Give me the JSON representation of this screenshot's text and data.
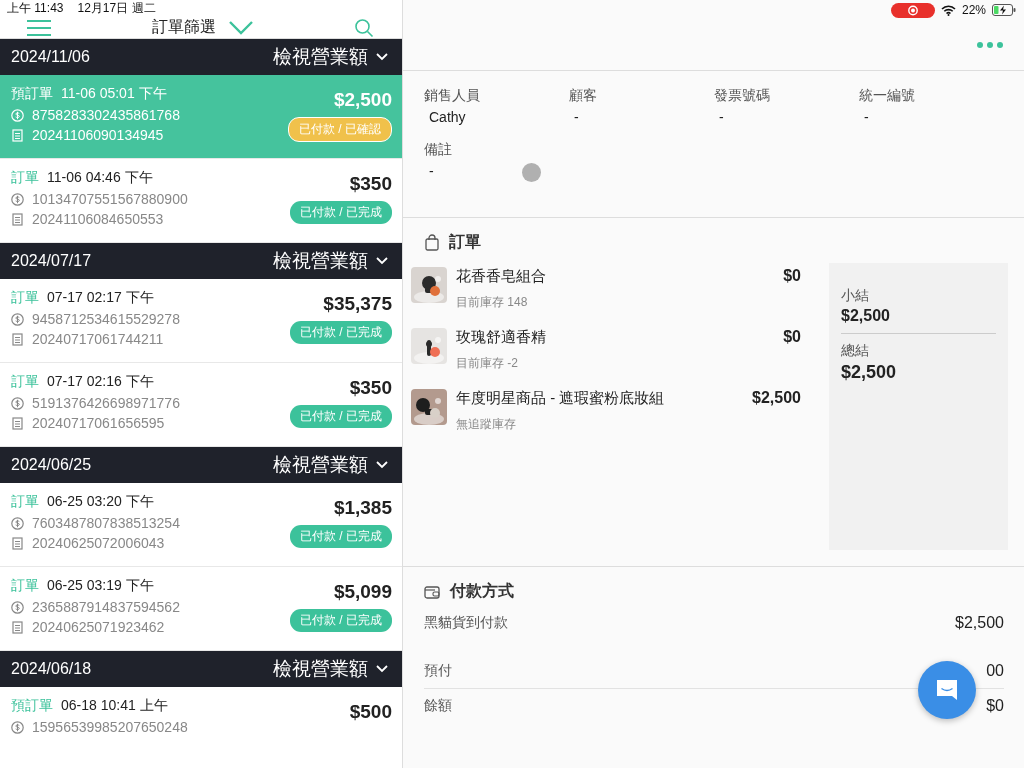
{
  "status_bar": {
    "time": "上午 11:43",
    "date": "12月17日 週二",
    "battery_text": "22%"
  },
  "nav": {
    "title": "訂單篩選"
  },
  "order_groups": [
    {
      "date": "2024/11/06",
      "action": "檢視營業額",
      "orders": [
        {
          "type": "預訂單",
          "time": "11-06 05:01 下午",
          "payment_no": "8758283302435861768",
          "order_no": "20241106090134945",
          "amount": "$2,500",
          "status": {
            "label": "已付款 / 已確認",
            "color": "#f0c14b"
          },
          "selected": true
        },
        {
          "type": "訂單",
          "time": "11-06 04:46 下午",
          "payment_no": "10134707551567880900",
          "order_no": "20241106084650553",
          "amount": "$350",
          "status": {
            "label": "已付款 / 已完成",
            "color": "#3cc29b"
          },
          "selected": false
        }
      ]
    },
    {
      "date": "2024/07/17",
      "action": "檢視營業額",
      "orders": [
        {
          "type": "訂單",
          "time": "07-17 02:17 下午",
          "payment_no": "9458712534615529278",
          "order_no": "20240717061744211",
          "amount": "$35,375",
          "status": {
            "label": "已付款 / 已完成",
            "color": "#3cc29b"
          },
          "selected": false
        },
        {
          "type": "訂單",
          "time": "07-17 02:16 下午",
          "payment_no": "5191376426698971776",
          "order_no": "20240717061656595",
          "amount": "$350",
          "status": {
            "label": "已付款 / 已完成",
            "color": "#3cc29b"
          },
          "selected": false
        }
      ]
    },
    {
      "date": "2024/06/25",
      "action": "檢視營業額",
      "orders": [
        {
          "type": "訂單",
          "time": "06-25 03:20 下午",
          "payment_no": "7603487807838513254",
          "order_no": "20240625072006043",
          "amount": "$1,385",
          "status": {
            "label": "已付款 / 已完成",
            "color": "#3cc29b"
          },
          "selected": false
        },
        {
          "type": "訂單",
          "time": "06-25 03:19 下午",
          "payment_no": "2365887914837594562",
          "order_no": "20240625071923462",
          "amount": "$5,099",
          "status": {
            "label": "已付款 / 已完成",
            "color": "#3cc29b"
          },
          "selected": false
        }
      ]
    },
    {
      "date": "2024/06/18",
      "action": "檢視營業額",
      "orders": [
        {
          "type": "預訂單",
          "time": "06-18 10:41 上午",
          "payment_no": "15956539985207650248",
          "amount": "$500",
          "selected": false
        }
      ]
    }
  ],
  "details": {
    "fields": [
      {
        "label": "銷售人員",
        "value": "Cathy"
      },
      {
        "label": "顧客",
        "value": "-"
      },
      {
        "label": "發票號碼",
        "value": "-"
      },
      {
        "label": "統一編號",
        "value": "-"
      }
    ],
    "note": {
      "label": "備註",
      "value": "-"
    }
  },
  "order_section": {
    "title": "訂單",
    "items": [
      {
        "name": "花香香皂組合",
        "stock": "目前庫存 148",
        "price": "$0"
      },
      {
        "name": "玫瑰舒適香精",
        "stock": "目前庫存 -2",
        "price": "$0"
      },
      {
        "name": "年度明星商品 - 遮瑕蜜粉底妝組",
        "stock": "無追蹤庫存",
        "price": "$2,500"
      }
    ],
    "totals": [
      {
        "label": "小結",
        "value": "$2,500",
        "kind": "subtotal"
      },
      {
        "label": "總結",
        "value": "$2,500",
        "kind": "total"
      }
    ]
  },
  "payment_section": {
    "title": "付款方式",
    "method": {
      "label": "黑貓貨到付款",
      "value": "$2,500"
    },
    "rows": [
      {
        "label": "預付",
        "value": "00"
      },
      {
        "label": "餘額",
        "value": "$0"
      }
    ]
  }
}
